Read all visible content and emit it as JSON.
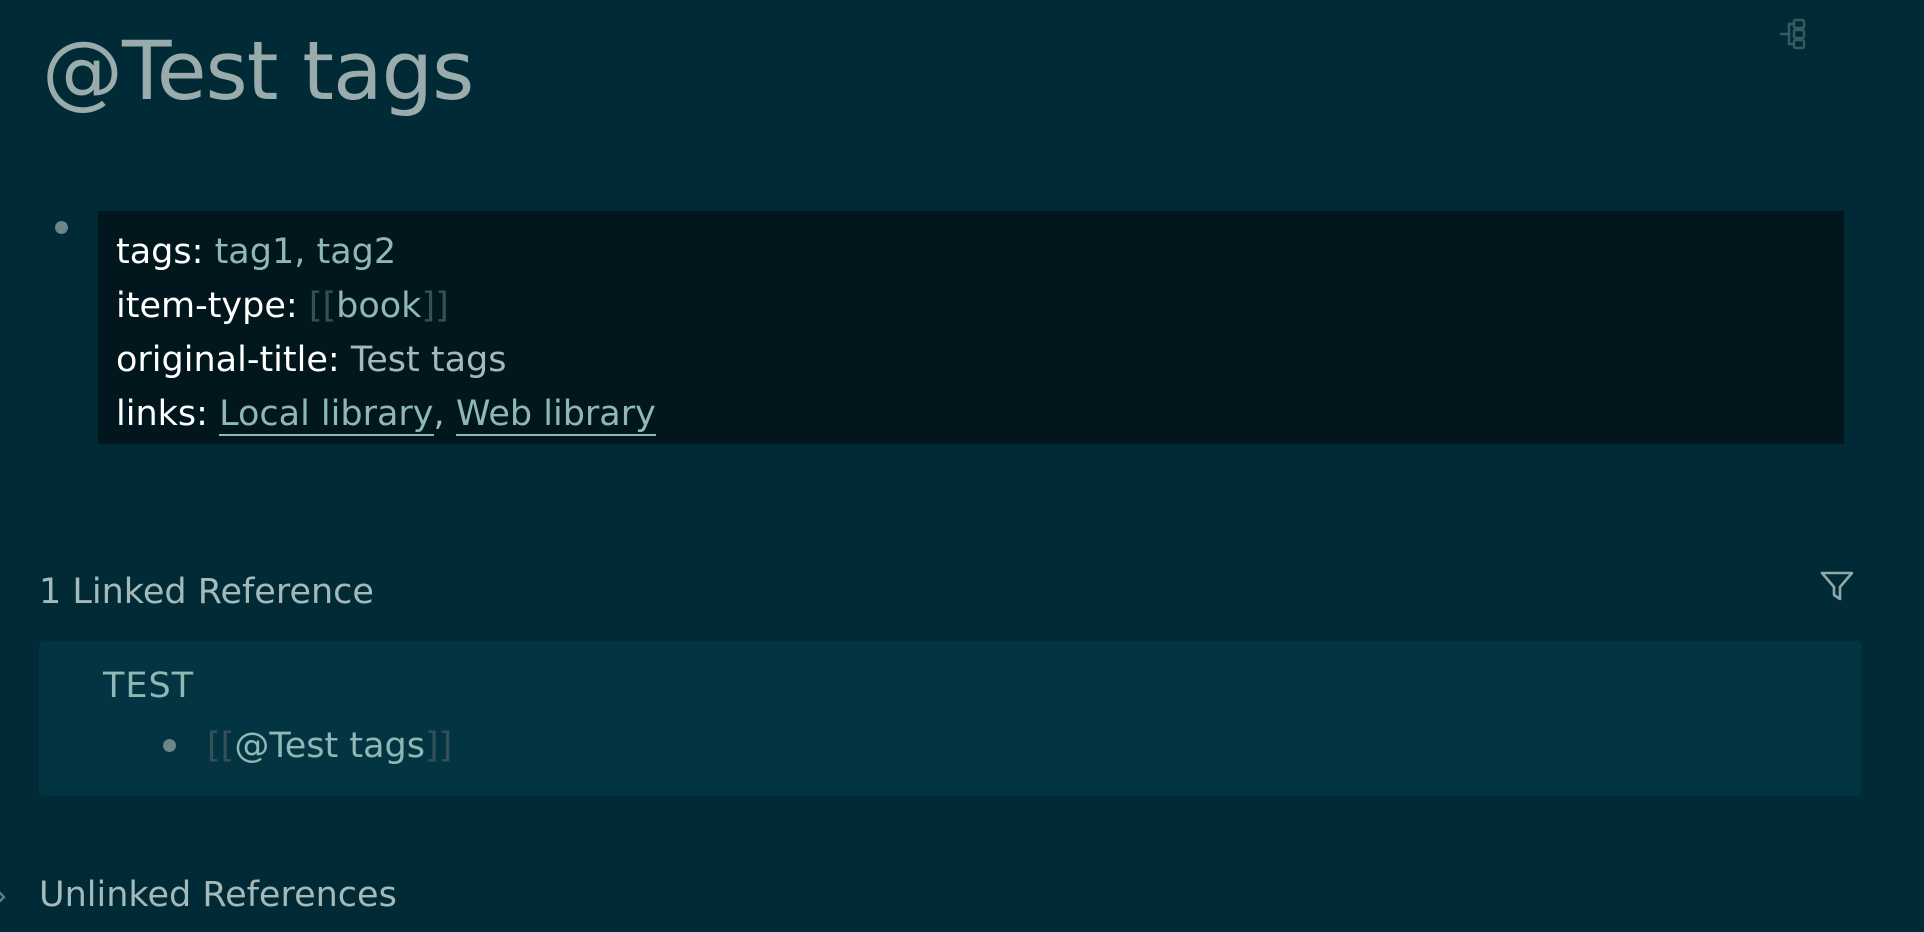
{
  "page": {
    "title": "@Test tags"
  },
  "icons": {
    "outline": "outline-toggle-icon",
    "filter": "filter-icon",
    "chevron": "chevron-right-icon"
  },
  "properties": {
    "separator": ":",
    "comma": ",",
    "open_bracket": "[[",
    "close_bracket": "]]",
    "rows": [
      {
        "key": "tags",
        "values": [
          "tag1",
          "tag2"
        ]
      },
      {
        "key": "item-type",
        "ref": "book"
      },
      {
        "key": "original-title",
        "text": "Test tags"
      },
      {
        "key": "links",
        "links": [
          "Local library",
          "Web library"
        ]
      }
    ]
  },
  "linked_references": {
    "heading": "1 Linked Reference",
    "groups": [
      {
        "page": "TEST",
        "blocks": [
          {
            "ref": "@Test tags"
          }
        ]
      }
    ]
  },
  "unlinked_references": {
    "heading": "Unlinked References"
  },
  "colors": {
    "background": "#002b36",
    "properties_bg": "#01171d",
    "reference_panel_bg": "#023541",
    "link": "#8fb7b4",
    "muted_text": "#a4b9b9"
  }
}
